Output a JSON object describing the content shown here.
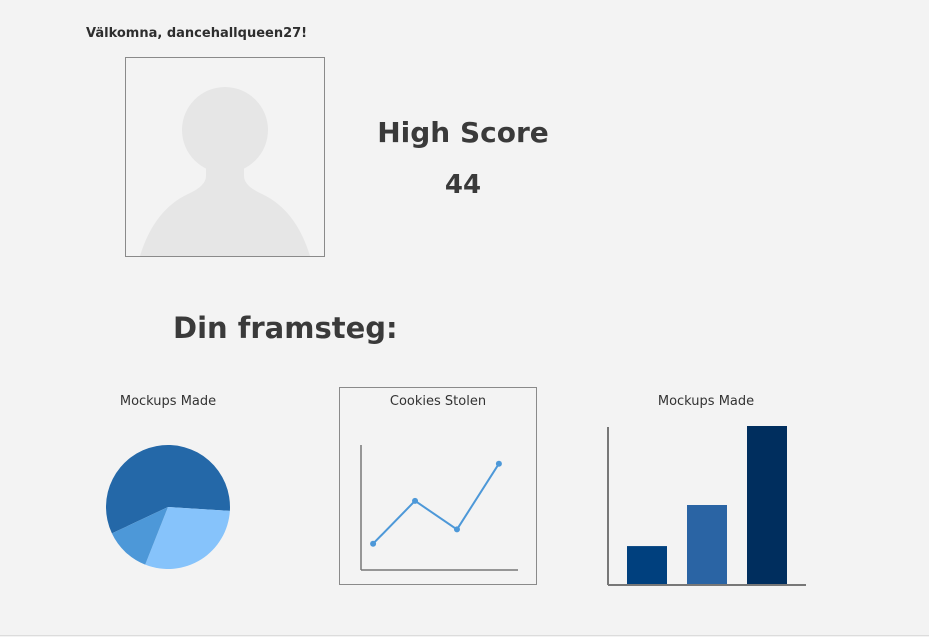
{
  "header": {
    "welcome": "Välkomna, dancehallqueen27!"
  },
  "profile": {
    "avatar_icon": "user-silhouette-icon"
  },
  "high_score": {
    "label": "High Score",
    "value": "44"
  },
  "progress": {
    "title": "Din framsteg:"
  },
  "colors": {
    "pie": [
      "#2468a8",
      "#86c3fb",
      "#4d98d8"
    ],
    "line": "#4d98d8",
    "bars": [
      "#00407e",
      "#2a64a4",
      "#002e5e"
    ]
  },
  "chart_data": [
    {
      "type": "pie",
      "title": "Mockups Made",
      "values": [
        58,
        30,
        12
      ]
    },
    {
      "type": "line",
      "title": "Cookies Stolen",
      "x": [
        1,
        2,
        3,
        4
      ],
      "y": [
        1,
        4,
        2,
        6.6
      ]
    },
    {
      "type": "bar",
      "title": "Mockups Made",
      "values": [
        2.4,
        5,
        10
      ]
    }
  ]
}
